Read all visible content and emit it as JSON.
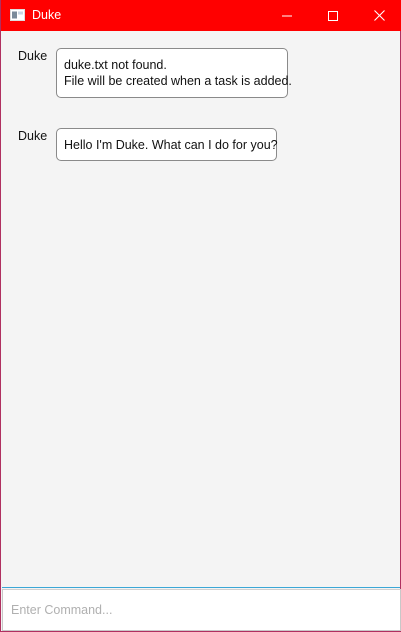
{
  "window": {
    "title": "Duke",
    "title_bar_color": "#ff0000",
    "controls": {
      "minimize_icon": "minimize-icon",
      "maximize_icon": "maximize-icon",
      "close_icon": "close-icon"
    }
  },
  "messages": [
    {
      "sender": "Duke",
      "lines": [
        "duke.txt not found.",
        "File will be created when a task is added."
      ]
    },
    {
      "sender": "Duke",
      "lines": [
        "Hello I'm Duke. What can I do for you?"
      ]
    }
  ],
  "input": {
    "placeholder": "Enter Command...",
    "value": ""
  }
}
